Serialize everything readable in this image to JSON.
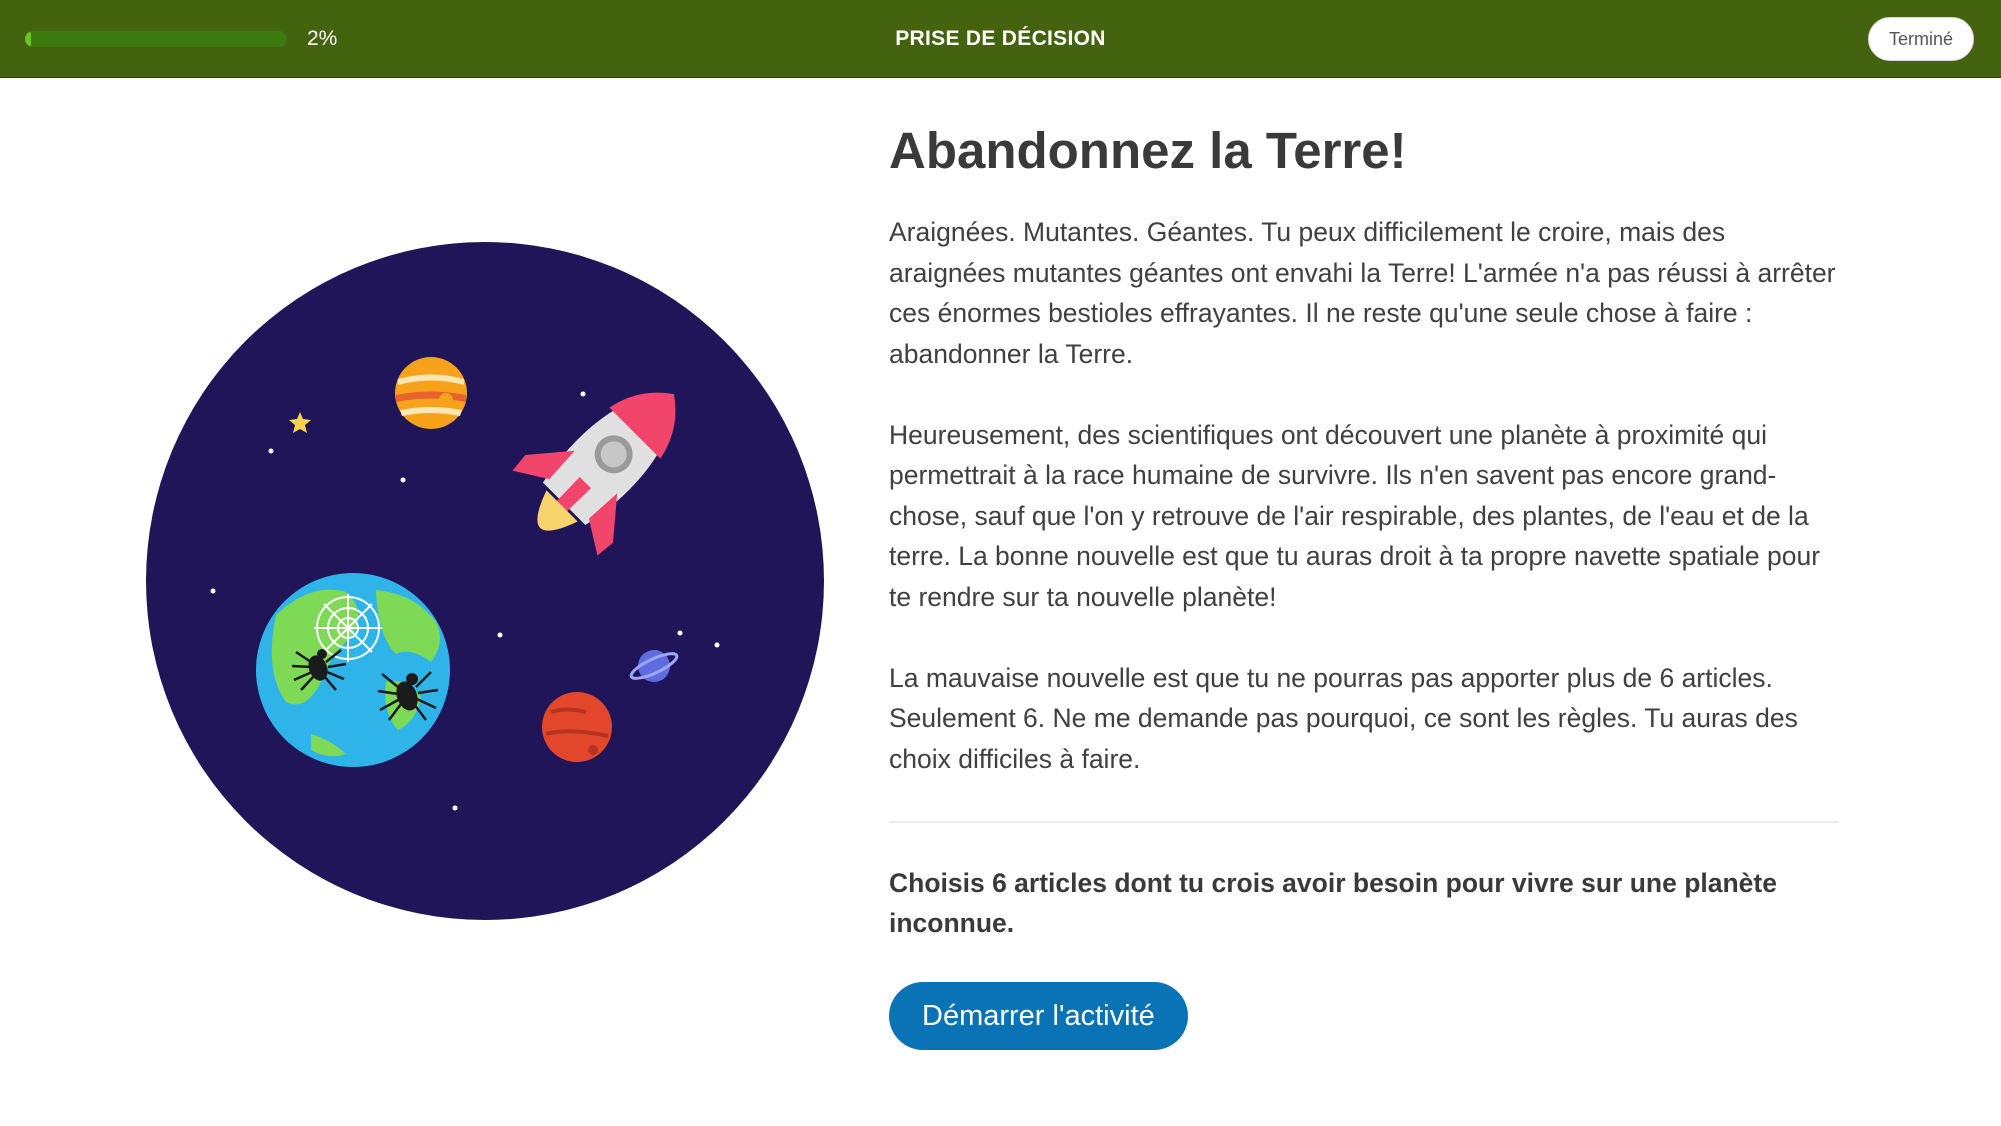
{
  "header": {
    "progress_text": "2%",
    "progress_fraction": 0.02,
    "title": "PRISE DE DÉCISION",
    "done_label": "Terminé"
  },
  "illustration": {
    "icons": [
      "space-circle",
      "rocket-icon",
      "earth-icon",
      "spider-icon",
      "spider-web-icon",
      "jupiter-planet-icon",
      "mars-planet-icon",
      "saturn-planet-icon",
      "star-icon"
    ],
    "colors": {
      "space": "#201558",
      "rocket_body": "#e0e0e0",
      "rocket_accent": "#f2456b",
      "flame": "#f7d36b",
      "ocean": "#2fb4ea",
      "land": "#7ed957"
    }
  },
  "main": {
    "title": "Abandonnez la Terre!",
    "paragraphs": [
      "Araignées. Mutantes. Géantes. Tu peux difficilement le croire, mais des araignées mutantes géantes ont envahi la Terre! L'armée n'a pas réussi à arrêter ces énormes bestioles effrayantes. Il ne reste qu'une seule chose à faire : abandonner la Terre.",
      "Heureusement, des scientifiques ont découvert une planète à proximité qui permettrait à la race humaine de survivre. Ils n'en savent pas encore grand-chose, sauf que l'on y retrouve de l'air respirable, des plantes, de l'eau et de la terre. La bonne nouvelle est que tu auras droit à ta propre navette spatiale pour te rendre sur ta nouvelle planète!",
      "La mauvaise nouvelle est que tu ne pourras pas apporter plus de 6 articles. Seulement 6. Ne me demande pas pourquoi, ce sont les règles. Tu auras des choix difficiles à faire."
    ],
    "prompt": "Choisis 6 articles dont tu crois avoir besoin pour vivre sur une planète inconnue.",
    "start_label": "Démarrer l'activité"
  },
  "colors": {
    "header_bg": "#44630f",
    "progress_fill": "#6ec322",
    "button_blue": "#0a73b5"
  }
}
